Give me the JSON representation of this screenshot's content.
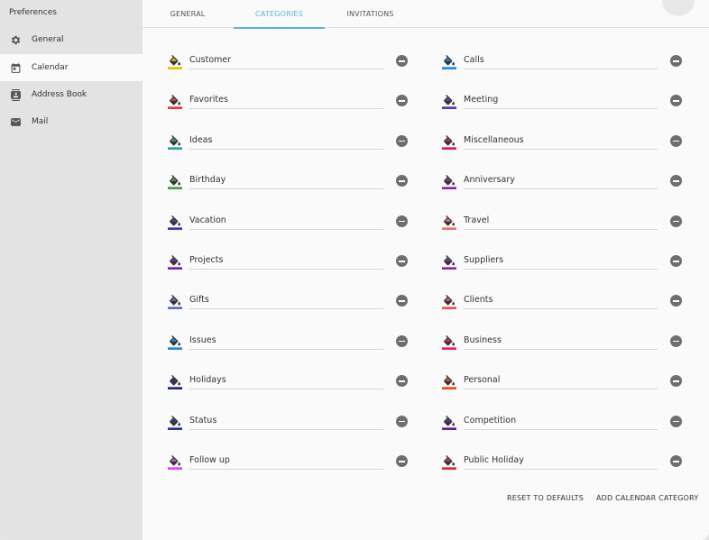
{
  "sidebar": {
    "title": "Preferences",
    "items": [
      {
        "label": "General",
        "icon": "gear-icon"
      },
      {
        "label": "Calendar",
        "icon": "calendar-icon"
      },
      {
        "label": "Address Book",
        "icon": "contact-book-icon"
      },
      {
        "label": "Mail",
        "icon": "envelope-icon"
      }
    ]
  },
  "tabs": [
    "GENERAL",
    "CATEGORIES",
    "INVITATIONS"
  ],
  "categories": [
    {
      "name": "Customer",
      "color": "#e6c000"
    },
    {
      "name": "Calls",
      "color": "#1e88e5"
    },
    {
      "name": "Favorites",
      "color": "#e53935"
    },
    {
      "name": "Meeting",
      "color": "#5e35b1"
    },
    {
      "name": "Ideas",
      "color": "#26a69a"
    },
    {
      "name": "Miscellaneous",
      "color": "#d81b60"
    },
    {
      "name": "Birthday",
      "color": "#43a047"
    },
    {
      "name": "Anniversary",
      "color": "#8e24aa"
    },
    {
      "name": "Vacation",
      "color": "#512da8"
    },
    {
      "name": "Travel",
      "color": "#e57373"
    },
    {
      "name": "Projects",
      "color": "#7b1fa2"
    },
    {
      "name": "Suppliers",
      "color": "#8e24aa"
    },
    {
      "name": "Gifts",
      "color": "#5c6bc0"
    },
    {
      "name": "Clients",
      "color": "#ef5350"
    },
    {
      "name": "Issues",
      "color": "#1e88e5"
    },
    {
      "name": "Business",
      "color": "#e91e63"
    },
    {
      "name": "Holidays",
      "color": "#1a237e"
    },
    {
      "name": "Personal",
      "color": "#e64a19"
    },
    {
      "name": "Status",
      "color": "#283593"
    },
    {
      "name": "Competition",
      "color": "#6a1b9a"
    },
    {
      "name": "Follow up",
      "color": "#e040fb"
    },
    {
      "name": "Public Holiday",
      "color": "#d32f2f"
    }
  ],
  "actions": {
    "reset": "RESET TO DEFAULTS",
    "add": "ADD CALENDAR CATEGORY"
  }
}
